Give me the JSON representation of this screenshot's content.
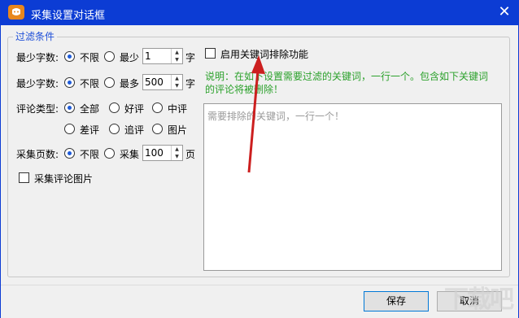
{
  "window": {
    "title": "采集设置对话框",
    "close_symbol": "✕"
  },
  "filter": {
    "legend": "过滤条件",
    "min_words_1": {
      "label": "最少字数:",
      "opt_unlimited": "不限",
      "opt_limit": "最少",
      "value": "1",
      "unit": "字"
    },
    "min_words_2": {
      "label": "最少字数:",
      "opt_unlimited": "不限",
      "opt_limit": "最多",
      "value": "500",
      "unit": "字"
    },
    "comment_type": {
      "label": "评论类型:",
      "options": [
        "全部",
        "好评",
        "中评",
        "差评",
        "追评",
        "图片"
      ]
    },
    "pages": {
      "label": "采集页数:",
      "opt_unlimited": "不限",
      "opt_limit": "采集",
      "value": "100",
      "unit": "页"
    },
    "collect_images": "采集评论图片"
  },
  "keywords": {
    "enable_label": "启用关键词排除功能",
    "note_line1": "说明：在如下设置需要过滤的关键词，一行一个。包含如下关键词",
    "note_line2": "的评论将被删除！",
    "placeholder": "需要排除的关键词，一行一个！"
  },
  "buttons": {
    "save": "保存",
    "cancel": "取消"
  },
  "watermark": "下载吧",
  "colors": {
    "titlebar": "#0c3cd4",
    "accent": "#1e5bd8",
    "note": "#2ba12b",
    "arrow": "#cc1f1f"
  }
}
